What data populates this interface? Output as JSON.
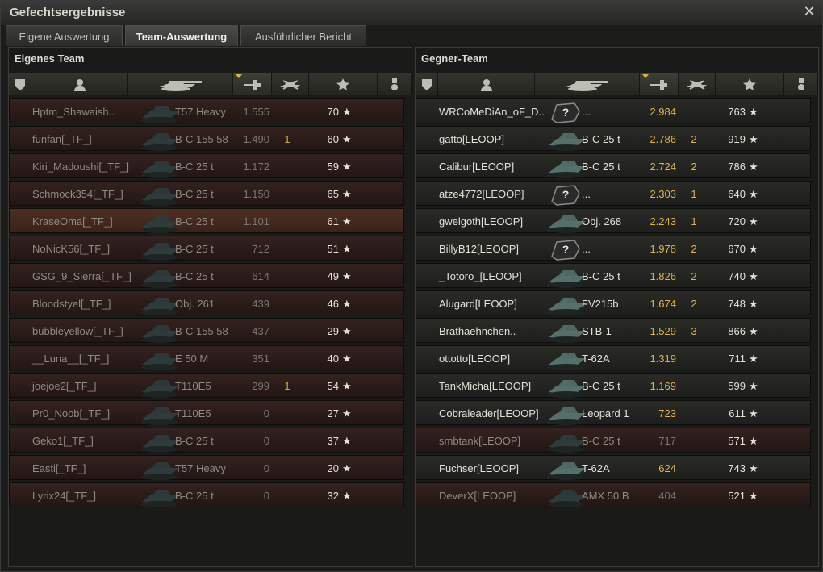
{
  "window": {
    "title": "Gefechtsergebnisse"
  },
  "tabs": [
    {
      "label": "Eigene Auswertung",
      "active": false
    },
    {
      "label": "Team-Auswertung",
      "active": true
    },
    {
      "label": "Ausführlicher Bericht",
      "active": false
    }
  ],
  "own_team": {
    "title": "Eigenes Team",
    "rows": [
      {
        "name": "Hptm_Shawaish..",
        "tank": "T57 Heavy",
        "damage": "1.555",
        "kills": "",
        "xp": "70",
        "state": "dead"
      },
      {
        "name": "funfan[_TF_]",
        "tank": "B-C 155 58",
        "damage": "1.490",
        "kills": "1",
        "xp": "60",
        "state": "dead"
      },
      {
        "name": "Kiri_Madoushi[_TF_]",
        "tank": "B-C 25 t",
        "damage": "1.172",
        "kills": "",
        "xp": "59",
        "state": "dead"
      },
      {
        "name": "Schmock354[_TF_]",
        "tank": "B-C 25 t",
        "damage": "1.150",
        "kills": "",
        "xp": "65",
        "state": "dead"
      },
      {
        "name": "KraseOma[_TF_]",
        "tank": "B-C 25 t",
        "damage": "1.101",
        "kills": "",
        "xp": "61",
        "state": "self"
      },
      {
        "name": "NoNicK56[_TF_]",
        "tank": "B-C 25 t",
        "damage": "712",
        "kills": "",
        "xp": "51",
        "state": "dead"
      },
      {
        "name": "GSG_9_Sierra[_TF_]",
        "tank": "B-C 25 t",
        "damage": "614",
        "kills": "",
        "xp": "49",
        "state": "dead"
      },
      {
        "name": "Bloodstyel[_TF_]",
        "tank": "Obj. 261",
        "damage": "439",
        "kills": "",
        "xp": "46",
        "state": "dead"
      },
      {
        "name": "bubbleyellow[_TF_]",
        "tank": "B-C 155 58",
        "damage": "437",
        "kills": "",
        "xp": "29",
        "state": "dead"
      },
      {
        "name": "__Luna__[_TF_]",
        "tank": "E 50 M",
        "damage": "351",
        "kills": "",
        "xp": "40",
        "state": "dead"
      },
      {
        "name": "joejoe2[_TF_]",
        "tank": "T110E5",
        "damage": "299",
        "kills": "1",
        "xp": "54",
        "state": "dead"
      },
      {
        "name": "Pr0_Noob[_TF_]",
        "tank": "T110E5",
        "damage": "0",
        "kills": "",
        "xp": "27",
        "state": "dead"
      },
      {
        "name": "Geko1[_TF_]",
        "tank": "B-C 25 t",
        "damage": "0",
        "kills": "",
        "xp": "37",
        "state": "dead"
      },
      {
        "name": "Easti[_TF_]",
        "tank": "T57 Heavy",
        "damage": "0",
        "kills": "",
        "xp": "20",
        "state": "dead"
      },
      {
        "name": "Lyrix24[_TF_]",
        "tank": "B-C 25 t",
        "damage": "0",
        "kills": "",
        "xp": "32",
        "state": "dead"
      }
    ]
  },
  "enemy_team": {
    "title": "Gegner-Team",
    "rows": [
      {
        "name": "WRCoMeDiAn_oF_D..",
        "tank": "...",
        "damage": "2.984",
        "kills": "",
        "xp": "763",
        "state": "alive",
        "unknown": true
      },
      {
        "name": "gatto[LEOOP]",
        "tank": "B-C 25 t",
        "damage": "2.786",
        "kills": "2",
        "xp": "919",
        "state": "alive"
      },
      {
        "name": "Calibur[LEOOP]",
        "tank": "B-C 25 t",
        "damage": "2.724",
        "kills": "2",
        "xp": "786",
        "state": "alive"
      },
      {
        "name": "atze4772[LEOOP]",
        "tank": "...",
        "damage": "2.303",
        "kills": "1",
        "xp": "640",
        "state": "alive",
        "unknown": true
      },
      {
        "name": "gwelgoth[LEOOP]",
        "tank": "Obj. 268",
        "damage": "2.243",
        "kills": "1",
        "xp": "720",
        "state": "alive"
      },
      {
        "name": "BillyB12[LEOOP]",
        "tank": "...",
        "damage": "1.978",
        "kills": "2",
        "xp": "670",
        "state": "alive",
        "unknown": true
      },
      {
        "name": "_Totoro_[LEOOP]",
        "tank": "B-C 25 t",
        "damage": "1.826",
        "kills": "2",
        "xp": "740",
        "state": "alive"
      },
      {
        "name": "Alugard[LEOOP]",
        "tank": "FV215b",
        "damage": "1.674",
        "kills": "2",
        "xp": "748",
        "state": "alive"
      },
      {
        "name": "Brathaehnchen..",
        "tank": "STB-1",
        "damage": "1.529",
        "kills": "3",
        "xp": "866",
        "state": "alive"
      },
      {
        "name": "ottotto[LEOOP]",
        "tank": "T-62A",
        "damage": "1.319",
        "kills": "",
        "xp": "711",
        "state": "alive"
      },
      {
        "name": "TankMicha[LEOOP]",
        "tank": "B-C 25 t",
        "damage": "1.169",
        "kills": "",
        "xp": "599",
        "state": "alive"
      },
      {
        "name": "Cobraleader[LEOOP]",
        "tank": "Leopard 1",
        "damage": "723",
        "kills": "",
        "xp": "611",
        "state": "alive"
      },
      {
        "name": "smbtank[LEOOP]",
        "tank": "B-C 25 t",
        "damage": "717",
        "kills": "",
        "xp": "571",
        "state": "dead"
      },
      {
        "name": "Fuchser[LEOOP]",
        "tank": "T-62A",
        "damage": "624",
        "kills": "",
        "xp": "743",
        "state": "alive"
      },
      {
        "name": "DeverX[LEOOP]",
        "tank": "AMX 50 B",
        "damage": "404",
        "kills": "",
        "xp": "521",
        "state": "dead"
      }
    ]
  },
  "columns": [
    "squad-icon",
    "player-icon",
    "tank-icon",
    "damage-icon",
    "kills-icon",
    "xp-star-icon",
    "medal-icon"
  ],
  "star_glyph": "★",
  "colors": {
    "gold": "#e0b450",
    "dead_row": "#2e1e1b",
    "self_row": "#4e2f22"
  }
}
